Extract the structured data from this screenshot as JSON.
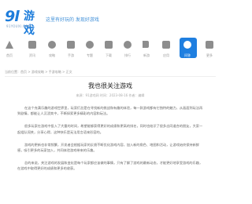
{
  "header": {
    "logo_num": "9l",
    "logo_cn": "游戏",
    "logo_sub": "91YOUXI.COM",
    "slogan": "这里有好玩的 发现好游戏"
  },
  "nav": {
    "items": [
      {
        "label": "首页",
        "icon": "home-icon"
      },
      {
        "label": "资讯",
        "icon": "news-icon"
      },
      {
        "label": "攻略",
        "icon": "guide-icon"
      },
      {
        "label": "手游",
        "icon": "gamepad-icon"
      },
      {
        "label": "专题",
        "icon": "topic-icon"
      },
      {
        "label": "下载",
        "icon": "download-icon"
      },
      {
        "label": "排行",
        "icon": "rank-icon"
      },
      {
        "label": "新游",
        "icon": "flag-icon"
      },
      {
        "label": "应用",
        "icon": "app-icon"
      },
      {
        "label": "问答",
        "icon": "qa-icon"
      },
      {
        "label": "更多",
        "icon": "more-icon"
      }
    ],
    "active_index": 9,
    "accent_color": "#1f7fe0"
  },
  "breadcrumb": "当前位置：首页 > 游戏攻略 > 手游攻略 > 正文",
  "article": {
    "title": "我也很关注游戏",
    "meta": "来源：91游戏网 时间：2023-08-16 作者：编辑",
    "paragraphs": [
      "在这个充满乐趣的游戏世界里，玩家们总是在寻找新的挑战和有趣的体验，每一款游戏都有它独特的魅力，从画面到玩法再到剧情，都能让人沉浸其中，不断探索更多精彩的内容和玩法。",
      "很多玩家在游戏中投入了大量的时间，希望能够获得更好的成绩和更高的排名，同时也结识了很多志同道合的朋友，大家一起组队闯关，分享心得，这种快乐是无法用言语来形容的。",
      "游戏的更新也非常频繁，开发者会根据玩家的反馈不断优化游戏内容，加入新的角色、地图和活动，让游戏始终保持新鲜感，吸引更多的玩家加入，共同体验游戏带来的乐趣。",
      "总的来说，关注游戏的发展和变化是每个玩家都应该做的事情，只有了解了游戏的最新动态，才能更好地享受游戏的乐趣，在游戏中取得更好的成绩和更多的收获。"
    ]
  }
}
